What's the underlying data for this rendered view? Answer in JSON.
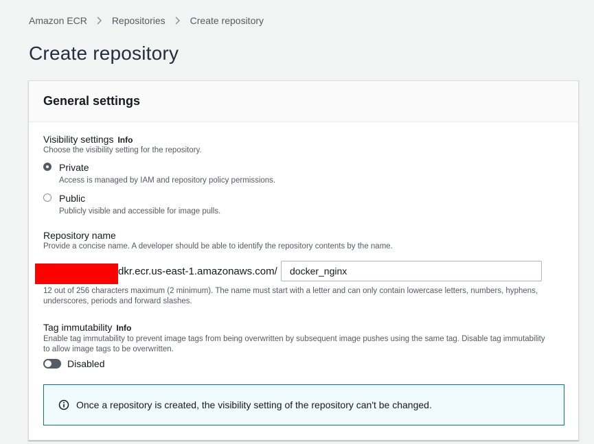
{
  "breadcrumb": {
    "items": [
      "Amazon ECR",
      "Repositories",
      "Create repository"
    ]
  },
  "page": {
    "title": "Create repository"
  },
  "general_settings": {
    "title": "General settings",
    "visibility": {
      "label": "Visibility settings",
      "info": "Info",
      "description": "Choose the visibility setting for the repository.",
      "options": [
        {
          "label": "Private",
          "description": "Access is managed by IAM and repository policy permissions.",
          "selected": true
        },
        {
          "label": "Public",
          "description": "Publicly visible and accessible for image pulls.",
          "selected": false
        }
      ]
    },
    "repository_name": {
      "label": "Repository name",
      "description": "Provide a concise name. A developer should be able to identify the repository contents by the name.",
      "uri_prefix": "dkr.ecr.us-east-1.amazonaws.com/",
      "value": "docker_nginx",
      "constraint": "12 out of 256 characters maximum (2 minimum). The name must start with a letter and can only contain lowercase letters, numbers, hyphens, underscores, periods and forward slashes."
    },
    "tag_immutability": {
      "label": "Tag immutability",
      "info": "Info",
      "description": "Enable tag immutability to prevent image tags from being overwritten by subsequent image pushes using the same tag. Disable tag immutability to allow image tags to be overwritten.",
      "state_label": "Disabled",
      "enabled": false
    },
    "alert": {
      "text": "Once a repository is created, the visibility setting of the repository can't be changed."
    }
  },
  "colors": {
    "background": "#f2f3f3",
    "alert_border": "#0073bb",
    "alert_background": "#f1faff",
    "redaction": "#ff0000"
  }
}
